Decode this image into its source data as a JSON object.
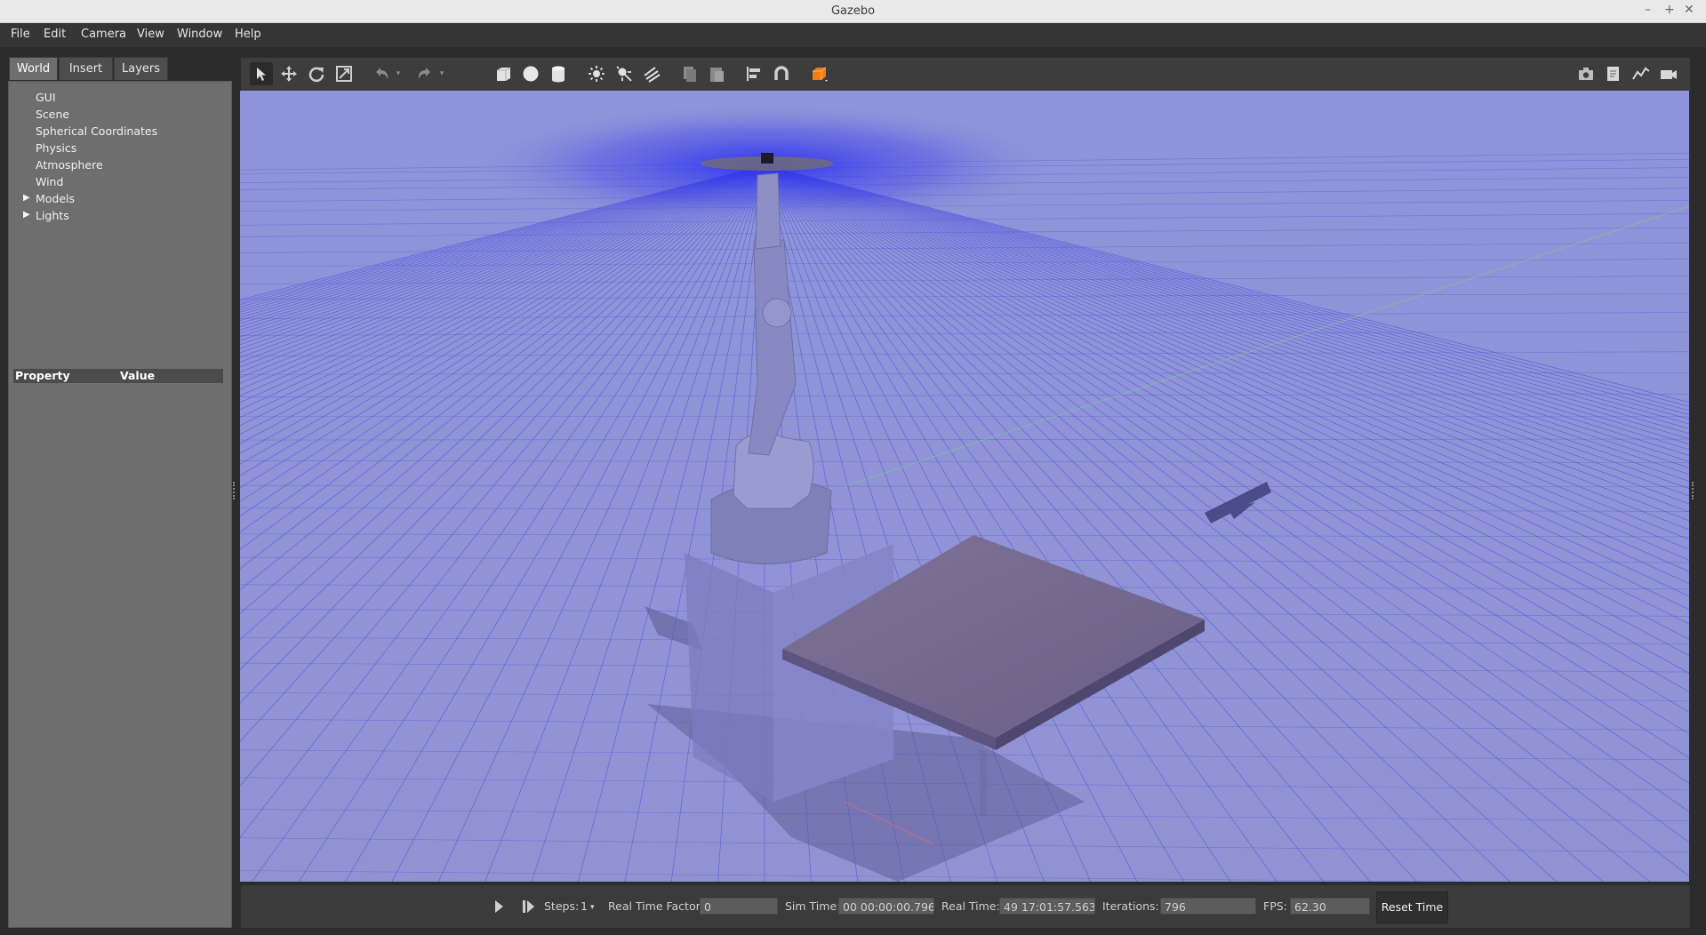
{
  "window": {
    "title": "Gazebo",
    "minimize": "–",
    "maximize": "+",
    "close": "✕"
  },
  "menu": [
    "File",
    "Edit",
    "Camera",
    "View",
    "Window",
    "Help"
  ],
  "tabs": [
    "World",
    "Insert",
    "Layers"
  ],
  "tree": {
    "items": [
      "GUI",
      "Scene",
      "Spherical Coordinates",
      "Physics",
      "Atmosphere",
      "Wind",
      "Models",
      "Lights"
    ],
    "expandable": [
      "Models",
      "Lights"
    ]
  },
  "properties": {
    "col_property": "Property",
    "col_value": "Value"
  },
  "toolbar": {
    "icons": [
      "select-arrow-icon",
      "translate-icon",
      "rotate-icon",
      "scale-icon",
      "undo-icon",
      "undo-dropdown-icon",
      "redo-icon",
      "redo-dropdown-icon",
      "box-icon",
      "sphere-icon",
      "cylinder-icon",
      "point-light-icon",
      "spot-light-icon",
      "directional-light-icon",
      "copy-icon",
      "paste-icon",
      "align-icon",
      "snap-icon",
      "view-angle-icon",
      "screenshot-icon",
      "log-icon",
      "plot-icon",
      "video-record-icon"
    ]
  },
  "bottom": {
    "steps_label": "Steps:",
    "steps_value": "1",
    "rtf_label": "Real Time Factor:",
    "rtf_value": "0",
    "sim_time_label": "Sim Time:",
    "sim_time_value": "00 00:00:00.796",
    "real_time_label": "Real Time:",
    "real_time_value": "49 17:01:57.563",
    "iterations_label": "Iterations:",
    "iterations_value": "796",
    "fps_label": "FPS:",
    "fps_value": "62.30",
    "reset_label": "Reset Time"
  },
  "colors": {
    "accent_orange": "#f07d18",
    "sky": "#8c90d8"
  }
}
